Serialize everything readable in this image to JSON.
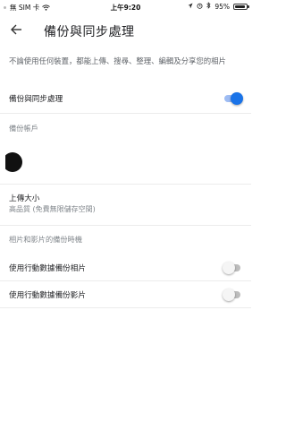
{
  "status_bar": {
    "carrier": "無 SIM 卡",
    "time": "上午9:20",
    "battery": "95%",
    "battery_level": 0.95
  },
  "app_bar": {
    "title": "備份與同步處理",
    "back_icon": "arrow-left-icon"
  },
  "description": "不論使用任何裝置，都能上傳、搜尋、整理、編輯及分享您的相片",
  "backup_sync": {
    "label": "備份與同步處理",
    "enabled": true
  },
  "account": {
    "header": "備份帳戶"
  },
  "upload_size": {
    "label": "上傳大小",
    "value": "高品質 (免費無限儲存空間)"
  },
  "cellular": {
    "header": "相片和影片的備份時機",
    "photos_label": "使用行動數據備份相片",
    "photos_enabled": false,
    "videos_label": "使用行動數據備份影片",
    "videos_enabled": false
  },
  "colors": {
    "accent": "#1a73e8",
    "divider": "#ececec"
  }
}
